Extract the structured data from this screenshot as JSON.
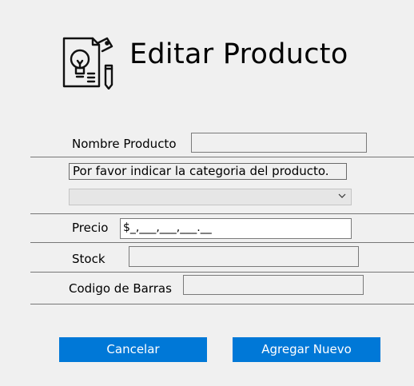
{
  "header": {
    "title": "Editar Producto",
    "icon": "product-lightbulb-document-icon"
  },
  "form": {
    "name_label": "Nombre Producto",
    "name_value": "",
    "category_notice": "Por favor indicar la categoria del producto.",
    "category_selected": "",
    "price_label": "Precio",
    "price_mask": "$_,___,___,___.__",
    "stock_label": "Stock",
    "stock_value": "",
    "barcode_label": "Codigo de Barras",
    "barcode_value": ""
  },
  "actions": {
    "cancel_label": "Cancelar",
    "submit_label": "Agregar Nuevo"
  },
  "colors": {
    "accent": "#0078d7",
    "background": "#f0f0f0"
  }
}
